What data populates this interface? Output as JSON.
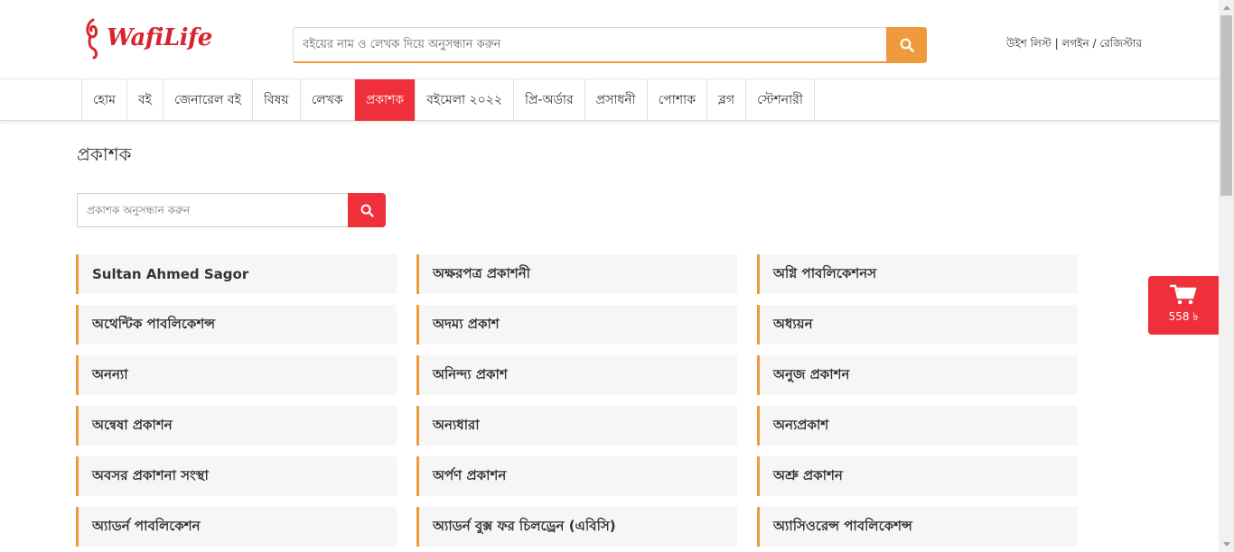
{
  "header": {
    "logo_text": "WafiLife",
    "search_placeholder": "বইয়ের নাম ও লেখক দিয়ে অনুসন্ধান করুন",
    "wishlist": "উইশ লিস্ট",
    "login": "লগইন",
    "register": "রেজিস্টার"
  },
  "nav": {
    "items": [
      "হোম",
      "বই",
      "জেনারেল বই",
      "বিষয়",
      "লেখক",
      "প্রকাশক",
      "বইমেলা ২০২২",
      "প্রি-অর্ডার",
      "প্রসাধনী",
      "পোশাক",
      "ব্লগ",
      "স্টেশনারী"
    ],
    "active": "প্রকাশক"
  },
  "page": {
    "title": "প্রকাশক",
    "search_placeholder": "প্রকাশক অনুসন্ধান করুন"
  },
  "publishers": [
    "Sultan Ahmed Sagor",
    "অক্ষরপত্র প্রকাশনী",
    "অগ্নি পাবলিকেশনস",
    "অথেন্টিক পাবলিকেশন্স",
    "অদম্য প্রকাশ",
    "অধ্যয়ন",
    "অনন্যা",
    "অনিন্দ্য প্রকাশ",
    "অনুজ প্রকাশন",
    "অন্বেষা প্রকাশন",
    "অন্যধারা",
    "অন্যপ্রকাশ",
    "অবসর প্রকাশনা সংস্থা",
    "অর্পণ প্রকাশন",
    "অশ্রু প্রকাশন",
    "অ্যাডর্ন পাবলিকেশন",
    "অ্যাডর্ন বুক্স ফর চিলড্রেন (এবিসি)",
    "অ্যাসিওরেন্স পাবলিকেশন্স"
  ],
  "cart": {
    "total": "558 ৳"
  },
  "icons": {
    "search": "search-icon",
    "cart": "cart-icon",
    "logo": "logo-mark-icon"
  },
  "colors": {
    "brand_red": "#ef2f39",
    "accent_orange": "#f09a3e"
  }
}
